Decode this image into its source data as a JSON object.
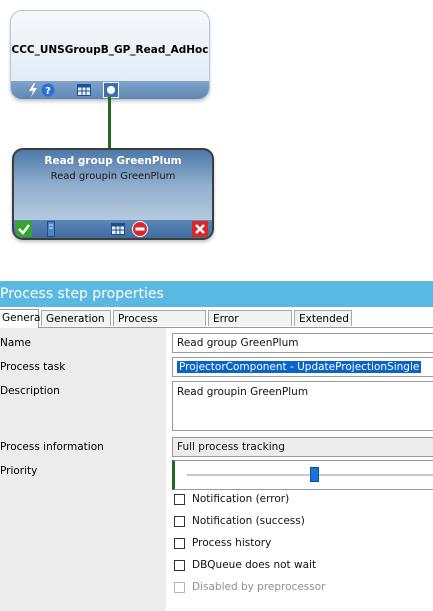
{
  "diagram": {
    "top_node": {
      "title": "CCC_UNSGroupB_GP_Read_AdHoc",
      "icons": [
        "lightning-icon",
        "help-icon",
        "table-icon",
        "dot-icon"
      ]
    },
    "bottom_node": {
      "title": "Read group GreenPlum",
      "subtitle": "Read groupin GreenPlum",
      "icons": [
        "checkmark-icon",
        "server-icon",
        "table-icon",
        "stop-icon",
        "close-icon"
      ]
    },
    "connector_color": "#1f6b1f"
  },
  "panel": {
    "title": "Process step properties",
    "tabs": [
      "General",
      "Generation",
      "Process tracking",
      "Error handling",
      "Extended"
    ],
    "active_tab": "General",
    "fields": {
      "name_label": "Name",
      "name_value": "Read group GreenPlum",
      "task_label": "Process task",
      "task_value": "ProjectorComponent - UpdateProjectionSingle",
      "description_label": "Description",
      "description_value": "Read groupin GreenPlum",
      "info_label": "Process information",
      "info_value": "Full process tracking",
      "priority_label": "Priority",
      "priority_level": 0.5
    },
    "checkboxes": [
      {
        "label": "Notification (error)",
        "checked": false,
        "disabled": false
      },
      {
        "label": "Notification (success)",
        "checked": false,
        "disabled": false
      },
      {
        "label": "Process history",
        "checked": false,
        "disabled": false
      },
      {
        "label": "DBQueue does not wait",
        "checked": false,
        "disabled": false
      },
      {
        "label": "Disabled by preprocessor",
        "checked": false,
        "disabled": true
      }
    ]
  },
  "colors": {
    "header_bg": "#5ab9e3",
    "selection": "#0a63c9",
    "slider_accent": "#1f6b1f"
  }
}
